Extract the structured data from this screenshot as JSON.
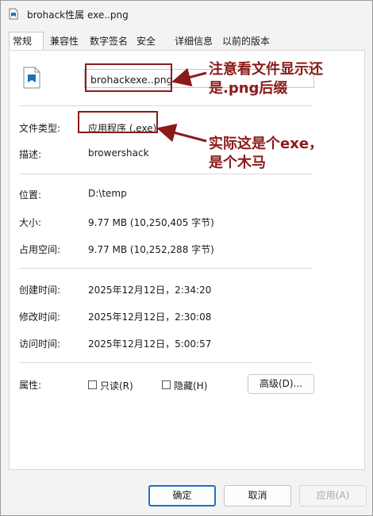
{
  "window": {
    "title": "brohack性属 exe..png"
  },
  "tabs": [
    {
      "label": "常规"
    },
    {
      "label": "兼容性"
    },
    {
      "label": "数字签名"
    },
    {
      "label": "安全"
    },
    {
      "label": "详细信息"
    },
    {
      "label": "以前的版本"
    }
  ],
  "general": {
    "file_name": "brohackexe..png",
    "rows": [
      {
        "label": "文件类型:",
        "value": "应用程序 (.exe)"
      },
      {
        "label": "描述:",
        "value": "browershack"
      },
      {
        "label": "位置:",
        "value": "D:\\temp"
      },
      {
        "label": "大小:",
        "value": "9.77 MB (10,250,405 字节)"
      },
      {
        "label": "占用空间:",
        "value": "9.77 MB (10,252,288 字节)"
      },
      {
        "label": "创建时间:",
        "value": "2025年12月12日，2:34:20"
      },
      {
        "label": "修改时间:",
        "value": "2025年12月12日，2:30:08"
      },
      {
        "label": "访问时间:",
        "value": "2025年12月12日，5:00:57"
      }
    ],
    "attributes_label": "属性:",
    "readonly_label": "只读(R)",
    "hidden_label": "隐藏(H)",
    "advanced_label": "高级(D)..."
  },
  "buttons": {
    "ok": "确定",
    "cancel": "取消",
    "apply": "应用(A)"
  },
  "annotations": {
    "callout1_line1": "注意看文件显示还",
    "callout1_line2": "是.png后缀",
    "callout2_line1": "实际这是个exe，",
    "callout2_line2": "是个木马",
    "color": "#8b1a1a"
  },
  "colors": {
    "primary_button_border": "#1f6fc5"
  }
}
